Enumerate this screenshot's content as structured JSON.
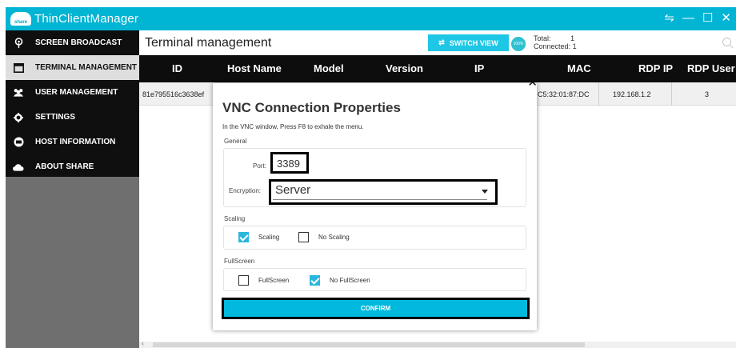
{
  "app": {
    "title": "ThinClientManager",
    "logo_text": "share"
  },
  "window_controls": {
    "network": "⇋",
    "minimize": "—",
    "maximize": "☐",
    "close": "✕"
  },
  "sidebar": {
    "items": [
      {
        "label": "SCREEN BROADCAST",
        "icon": "broadcast-icon"
      },
      {
        "label": "TERMINAL MANAGEMENT",
        "icon": "terminal-icon",
        "active": true
      },
      {
        "label": "USER MANAGEMENT",
        "icon": "users-icon"
      },
      {
        "label": "SETTINGS",
        "icon": "gear-icon"
      },
      {
        "label": "HOST INFORMATION",
        "icon": "host-icon"
      },
      {
        "label": "ABOUT SHARE",
        "icon": "cloud-icon"
      }
    ]
  },
  "header": {
    "page_title": "Terminal management",
    "switch_view": "SWITCH VIEW",
    "badge": "100%",
    "total_label": "Total:",
    "total_value": "1",
    "connected_label": "Connected:",
    "connected_value": "1"
  },
  "table": {
    "columns": [
      "ID",
      "Host Name",
      "Model",
      "Version",
      "IP",
      "MAC",
      "RDP IP",
      "RDP User"
    ],
    "row": {
      "id": "81e795516c3638ef",
      "mac": "C5:32:01:87:DC",
      "rdp_ip": "192.168.1.2",
      "rdp_user": "3"
    }
  },
  "modal": {
    "close": "✕",
    "title": "VNC Connection Properties",
    "hint": "In the VNC window, Press F8 to exhale the menu.",
    "general_label": "General",
    "port_label": "Port:",
    "port_value": "3389",
    "encryption_label": "Encryption:",
    "encryption_value": "Server",
    "scaling_label": "Scaling",
    "scaling_opt": "Scaling",
    "no_scaling_opt": "No Scaling",
    "fullscreen_label": "FullScreen",
    "fullscreen_opt": "FullScreen",
    "no_fullscreen_opt": "No FullScreen",
    "confirm": "CONFIRM"
  },
  "colors": {
    "accent": "#00b4d4",
    "sidebar_bg": "#0f0f0f",
    "table_header": "#0d0d0d"
  }
}
